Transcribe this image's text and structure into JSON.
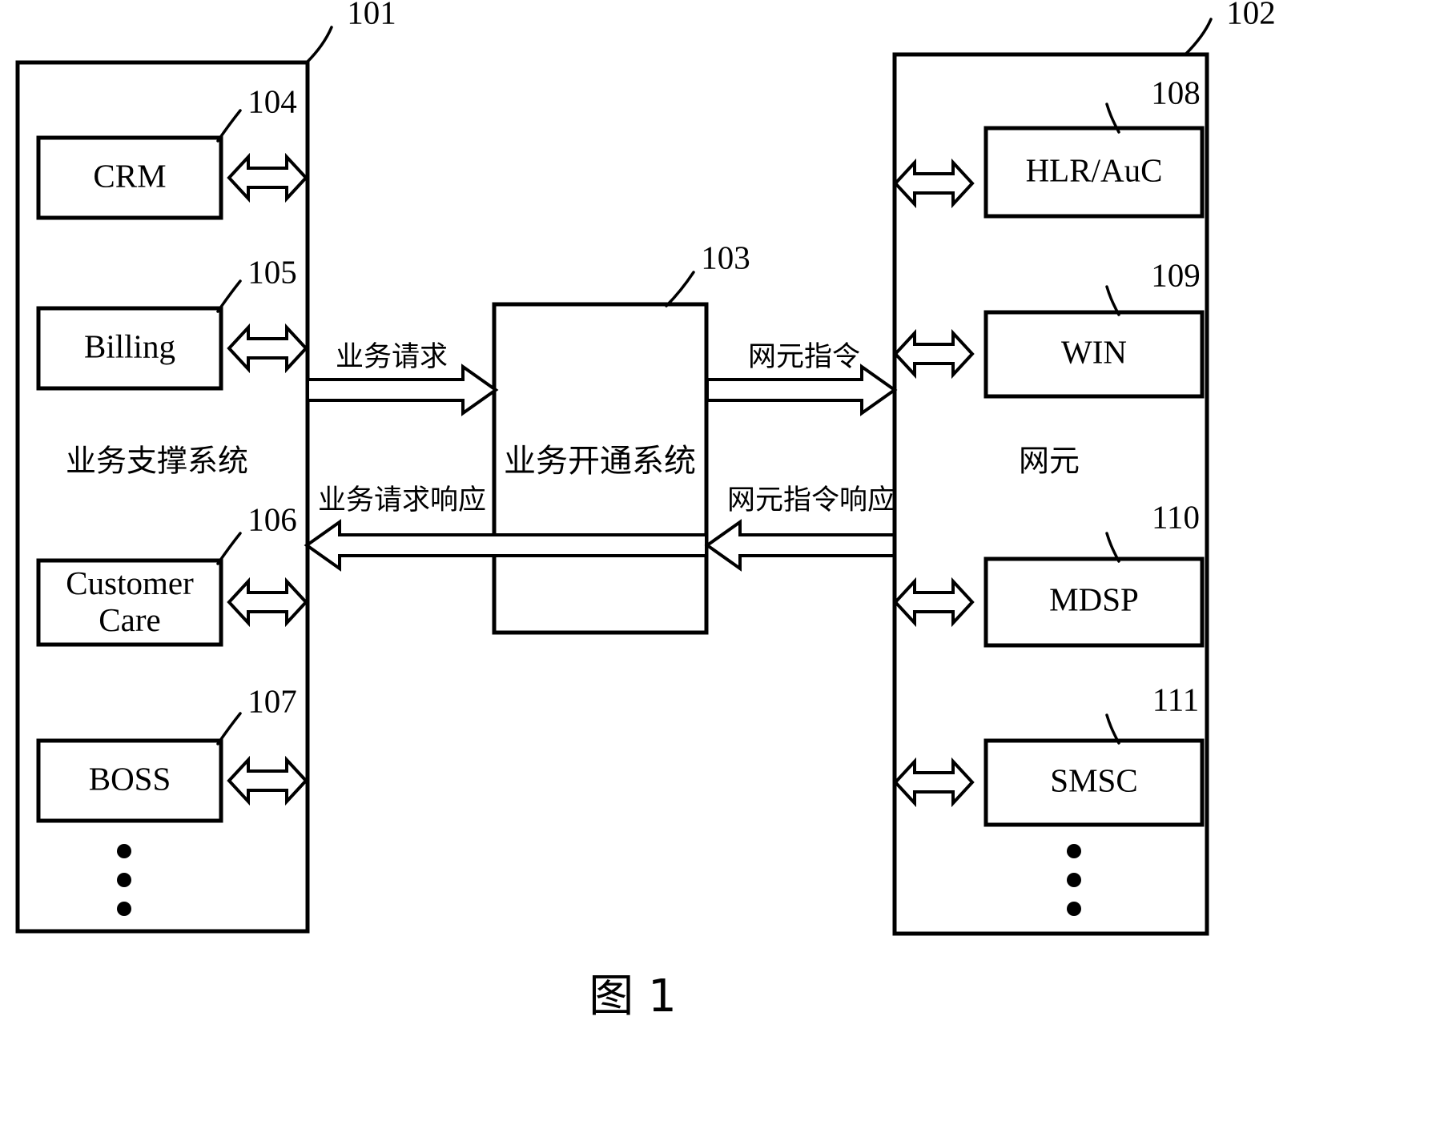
{
  "figure": {
    "caption": "图 1",
    "ref_left_panel": "101",
    "ref_right_panel": "102",
    "ref_center": "103"
  },
  "left_panel": {
    "title": "业务支撑系统",
    "ref": "101",
    "units": [
      {
        "label": "CRM",
        "label2": "",
        "ref": "104"
      },
      {
        "label": "Billing",
        "label2": "",
        "ref": "105"
      },
      {
        "label": "Customer",
        "label2": "Care",
        "ref": "106"
      },
      {
        "label": "BOSS",
        "label2": "",
        "ref": "107"
      }
    ],
    "ellipsis": "⋮"
  },
  "center": {
    "label": "业务开通系统",
    "ref": "103"
  },
  "right_panel": {
    "title": "网元",
    "ref": "102",
    "units": [
      {
        "label": "HLR/AuC",
        "label2": "",
        "ref": "108"
      },
      {
        "label": "WIN",
        "label2": "",
        "ref": "109"
      },
      {
        "label": "MDSP",
        "label2": "",
        "ref": "110"
      },
      {
        "label": "SMSC",
        "label2": "",
        "ref": "111"
      }
    ],
    "ellipsis": "⋮"
  },
  "flows": {
    "left_to_center": "业务请求",
    "center_to_left": "业务请求响应",
    "center_to_right": "网元指令",
    "right_to_center": "网元指令响应"
  },
  "colors": {
    "stroke": "#000000",
    "background": "#ffffff"
  }
}
